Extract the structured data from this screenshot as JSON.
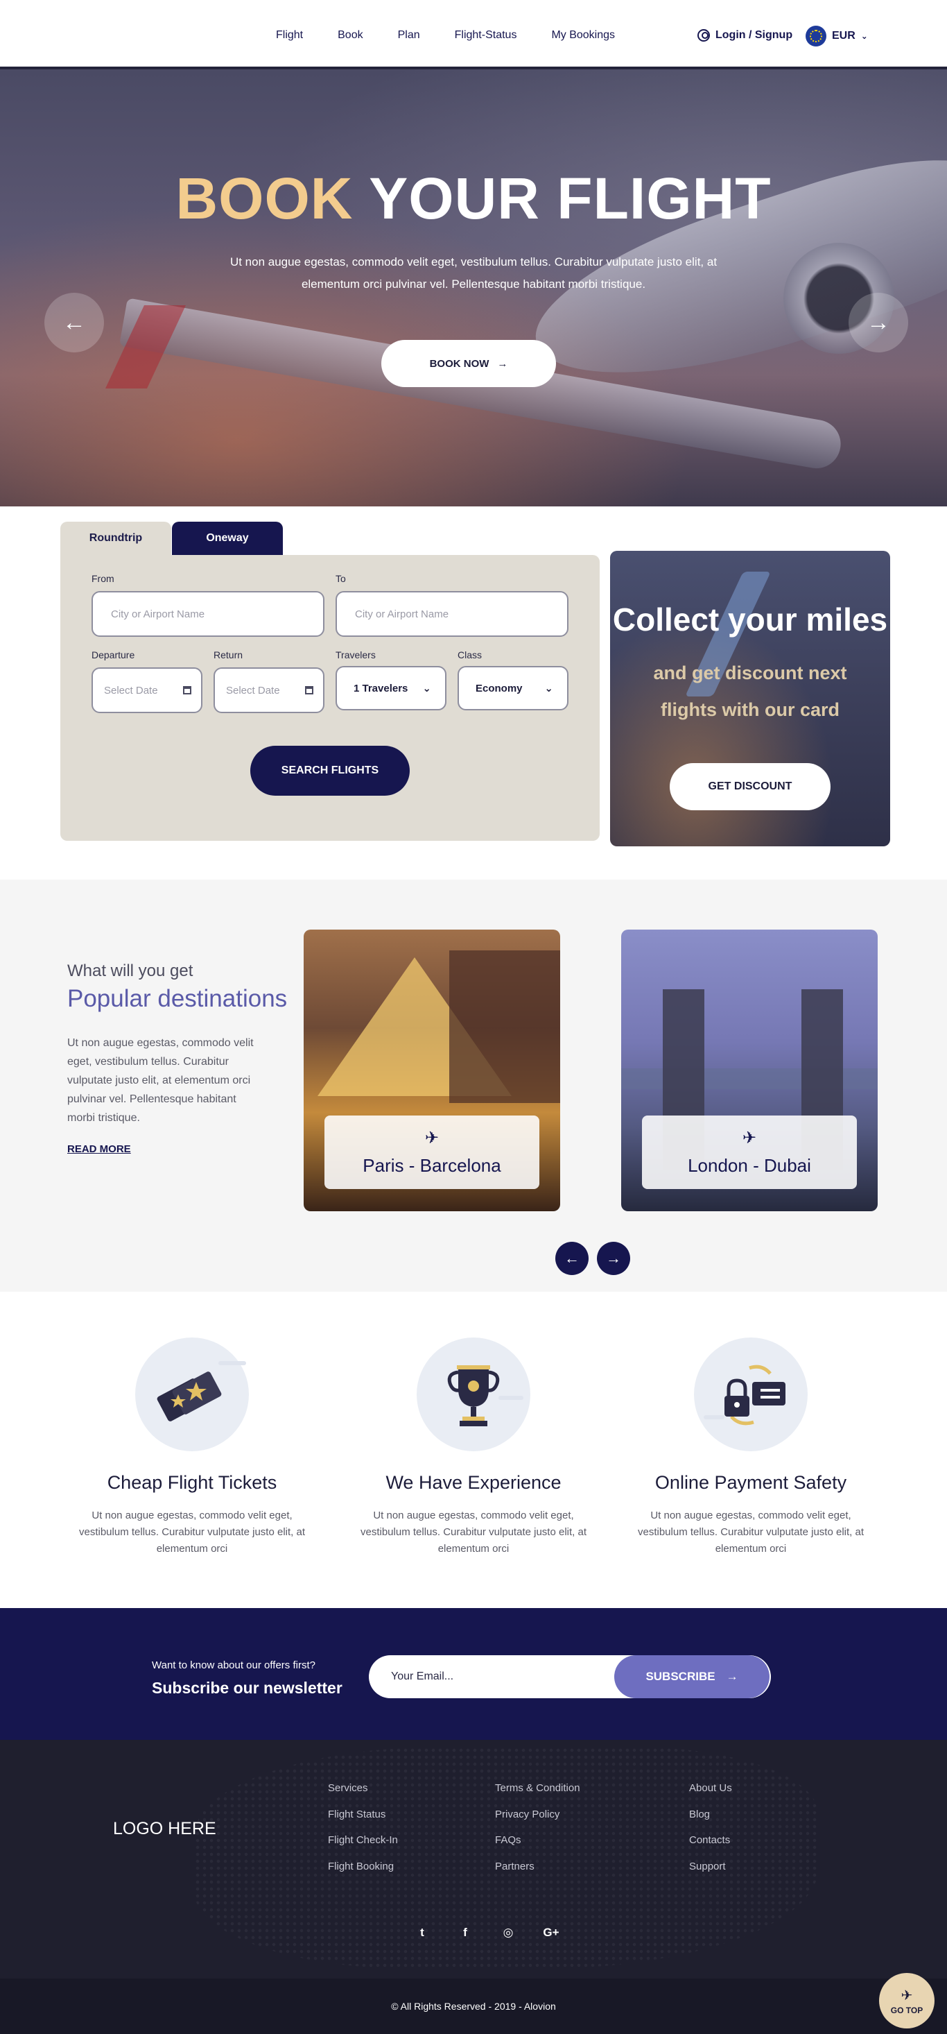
{
  "header": {
    "nav": [
      "Flight",
      "Book",
      "Plan",
      "Flight-Status",
      "My Bookings"
    ],
    "login_label": "Login / Signup",
    "currency": "EUR"
  },
  "hero": {
    "title_accent": "BOOK",
    "title_rest": "YOUR FLIGHT",
    "text": "Ut non augue egestas, commodo velit eget, vestibulum tellus. Curabitur vulputate justo elit, at elementum orci pulvinar vel. Pellentesque habitant morbi tristique.",
    "button": "BOOK NOW",
    "prev_icon": "←",
    "next_icon": "→"
  },
  "search": {
    "tabs": [
      "Roundtrip",
      "Oneway"
    ],
    "from_label": "From",
    "from_placeholder": "City or Airport Name",
    "to_label": "To",
    "to_placeholder": "City or Airport Name",
    "departure_label": "Departure",
    "departure_placeholder": "Select Date",
    "return_label": "Return",
    "return_placeholder": "Select Date",
    "travelers_label": "Travelers",
    "travelers_value": "1 Travelers",
    "class_label": "Class",
    "class_value": "Economy",
    "button": "SEARCH FLIGHTS"
  },
  "promo": {
    "title": "Collect your miles",
    "subtitle": "and get discount next flights with our card",
    "button": "GET DISCOUNT"
  },
  "destinations": {
    "kicker": "What will you get",
    "title": "Popular destinations",
    "text": "Ut non augue egestas, commodo velit eget, vestibulum tellus. Curabitur vulputate justo elit, at elementum orci pulvinar vel. Pellentesque habitant morbi tristique.",
    "read_more": "READ MORE",
    "cards": [
      {
        "name": "Paris - Barcelona"
      },
      {
        "name": "London - Dubai"
      }
    ]
  },
  "features": [
    {
      "title": "Cheap Flight Tickets",
      "text": "Ut non augue egestas, commodo velit eget, vestibulum tellus. Curabitur vulputate justo elit, at elementum orci",
      "icon": "ticket-icon"
    },
    {
      "title": "We Have Experience",
      "text": "Ut non augue egestas, commodo velit eget, vestibulum tellus. Curabitur vulputate justo elit, at elementum orci",
      "icon": "trophy-icon"
    },
    {
      "title": "Online Payment Safety",
      "text": "Ut non augue egestas, commodo velit eget, vestibulum tellus. Curabitur vulputate justo elit, at elementum orci",
      "icon": "secure-payment-icon"
    }
  ],
  "newsletter": {
    "kicker": "Want to know about our offers first?",
    "title": "Subscribe our newsletter",
    "placeholder": "Your Email...",
    "button": "SUBSCRIBE"
  },
  "footer": {
    "logo": "LOGO HERE",
    "col1": [
      "Services",
      "Flight Status",
      "Flight Check-In",
      "Flight Booking"
    ],
    "col2": [
      "Terms & Condition",
      "Privacy Policy",
      "FAQs",
      "Partners"
    ],
    "col3": [
      "About Us",
      "Blog",
      "Contacts",
      "Support"
    ],
    "social": [
      "twitter-icon",
      "facebook-icon",
      "instagram-icon",
      "google-plus-icon"
    ],
    "copyright": "© All Rights Reserved - 2019 - Alovion",
    "go_top": "GO TOP"
  },
  "colors": {
    "navy": "#16164f",
    "accent_gold": "#f3cc8e",
    "lavender": "#6e6ec0",
    "panel_beige": "#e0dcd3"
  }
}
